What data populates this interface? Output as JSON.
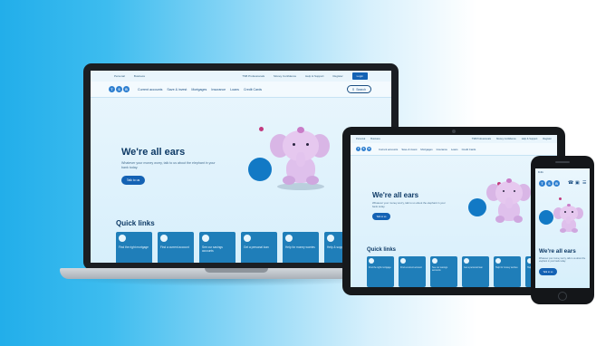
{
  "site": {
    "utility_links": [
      "Personal",
      "Business",
      "TSB Professionals",
      "Money Confidence",
      "Help & Support",
      "Register"
    ],
    "login_label": "Login",
    "logo_letters": [
      "T",
      "S",
      "B"
    ],
    "nav_items": [
      "Current accounts",
      "Save & invest",
      "Mortgages",
      "Insurance",
      "Loans",
      "Credit Cards"
    ],
    "search_label": "Search",
    "hero_title": "We're all ears",
    "hero_subtitle": "Whatever your money worry, talk to us about the elephant in your bank today.",
    "cta_label": "Talk to us",
    "quick_links_title": "Quick links",
    "quick_links": [
      "Find the right mortgage",
      "Find a current account",
      "See our savings accounts",
      "Get a personal loan",
      "Help for money worries",
      "Help & support"
    ],
    "phone_time": "9:41"
  },
  "colors": {
    "brand_blue": "#1462b4",
    "tile_blue": "#1f7eb9",
    "heading_navy": "#0e3a66",
    "accent_pink": "#c23a7f",
    "elephant_lilac": "#e6c8ef"
  }
}
